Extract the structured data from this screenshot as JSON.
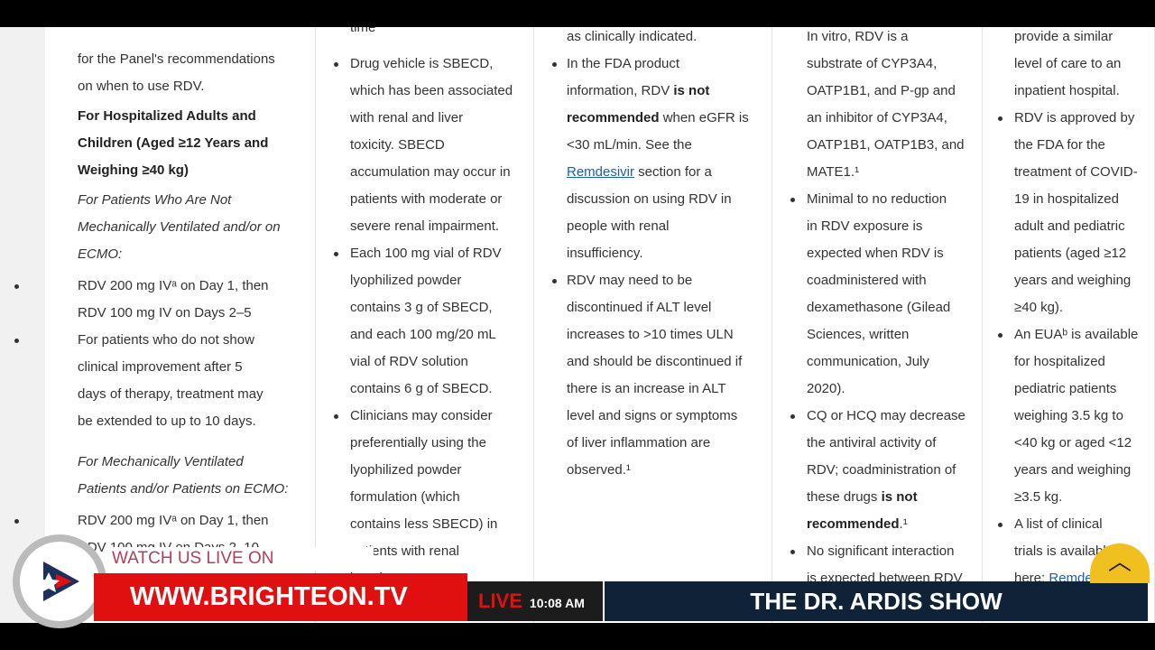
{
  "columns": [
    {
      "blocks": [
        {
          "style": "",
          "lines": [
            "for the Panel's recommendations",
            "on when to use RDV."
          ]
        },
        {
          "style": "b",
          "lines": [
            "For Hospitalized Adults and",
            "Children (Aged ≥12 Years and",
            "Weighing ≥40 kg)"
          ]
        },
        {
          "style": "i",
          "lines": [
            "For Patients Who Are Not",
            "Mechanically Ventilated and/or on",
            "ECMO:"
          ]
        },
        {
          "bullet": true,
          "lines": [
            "RDV 200 mg IVᵃ on Day 1, then",
            "RDV 100 mg IV on Days 2–5"
          ]
        },
        {
          "bullet": true,
          "lines": [
            "For patients who do not show",
            "clinical improvement after 5",
            "days of therapy, treatment may",
            "be extended to up to 10 days."
          ]
        },
        {
          "style": "i",
          "lines": [
            "For Mechanically Ventilated",
            "Patients and/or Patients on ECMO:"
          ]
        },
        {
          "bullet": true,
          "lines": [
            "RDV 200 mg IVᵃ on Day 1, then",
            "RDV 100 mg IV on Days 2–10"
          ]
        }
      ]
    },
    {
      "blocks": [
        {
          "style": "",
          "lines": [
            "time"
          ]
        },
        {
          "bullet": true,
          "lines": [
            "Drug vehicle is SBECD,",
            "which has been associated",
            "with renal and liver",
            "toxicity. SBECD",
            "accumulation may occur in",
            "patients with moderate or",
            "severe renal impairment."
          ]
        },
        {
          "bullet": true,
          "lines": [
            "Each 100 mg vial of RDV",
            "lyophilized powder",
            "contains 3 g of SBECD,",
            "and each 100 mg/20 mL",
            "vial of RDV solution",
            "contains 6 g of SBECD."
          ]
        },
        {
          "bullet": true,
          "lines": [
            "Clinicians may consider",
            "preferentially using the",
            "lyophilized powder",
            "formulation (which",
            "contains less SBECD) in",
            "patients with renal",
            "impairment."
          ]
        }
      ]
    },
    {
      "blocks": [
        {
          "style": "",
          "lines": [
            "as clinically indicated."
          ]
        },
        {
          "bullet": true,
          "lines": [
            "In the FDA product",
            [
              [
                "information, RDV ",
                ""
              ],
              [
                "is not",
                "b"
              ]
            ],
            [
              [
                "recommended",
                "b"
              ],
              [
                " when eGFR is",
                ""
              ]
            ],
            "<30 mL/min. See the",
            [
              [
                "Remdesivir",
                "lnk"
              ],
              [
                " section for a",
                ""
              ]
            ],
            "discussion on using RDV in",
            "people with renal",
            "insufficiency."
          ]
        },
        {
          "bullet": true,
          "lines": [
            "RDV may need to be",
            "discontinued if ALT level",
            "increases to >10 times ULN",
            "and should be discontinued if",
            "there is an increase in ALT",
            "level and signs or symptoms",
            "of liver inflammation are",
            "observed.¹"
          ]
        }
      ]
    },
    {
      "blocks": [
        {
          "style": "",
          "lines": [
            "In vitro, RDV is a"
          ]
        },
        {
          "style": "",
          "lines": [
            "substrate of CYP3A4,",
            "OATP1B1, and P-gp and",
            "an inhibitor of CYP3A4,",
            "OATP1B1, OATP1B3, and",
            "MATE1.¹"
          ]
        },
        {
          "bullet": true,
          "lines": [
            "Minimal to no reduction",
            "in RDV exposure is",
            "expected when RDV is",
            "coadministered with",
            "dexamethasone (Gilead",
            "Sciences, written",
            "communication, July",
            "2020)."
          ]
        },
        {
          "bullet": true,
          "lines": [
            "CQ or HCQ may decrease",
            "the antiviral activity of",
            "RDV; coadministration of",
            [
              [
                "these drugs ",
                ""
              ],
              [
                "is not",
                "b"
              ]
            ],
            [
              [
                "recommended",
                "b"
              ],
              [
                ".¹",
                ""
              ]
            ]
          ]
        },
        {
          "bullet": true,
          "lines": [
            "No significant interaction",
            "is expected between RDV"
          ]
        }
      ]
    },
    {
      "blocks": [
        {
          "style": "",
          "lines": [
            "provide a similar",
            "level of care to an",
            "inpatient hospital."
          ]
        },
        {
          "bullet": true,
          "lines": [
            "RDV is approved by",
            "the FDA for the",
            "treatment of COVID-",
            "19 in hospitalized",
            "adult and pediatric",
            "patients (aged ≥12",
            "years and weighing",
            "≥40 kg)."
          ]
        },
        {
          "bullet": true,
          "lines": [
            "An EUAᵇ is available",
            "for hospitalized",
            "pediatric patients",
            "weighing 3.5 kg to",
            "<40 kg or aged <12",
            "years and weighing",
            "≥3.5 kg."
          ]
        },
        {
          "bullet": true,
          "lines": [
            "A list of clinical",
            "trials is available",
            [
              [
                "here: ",
                ""
              ],
              [
                "Remdesivir",
                "lnk"
              ]
            ]
          ]
        }
      ]
    }
  ],
  "overlay": {
    "watch": "WATCH US LIVE ON BRIGHTEON!",
    "url": "WWW.BRIGHTEON.TV",
    "live": "LIVE",
    "time": "10:08 AM",
    "show": "THE DR. ARDIS SHOW",
    "back_icon": "chevron-up-icon",
    "brand_color": "#e01010"
  }
}
